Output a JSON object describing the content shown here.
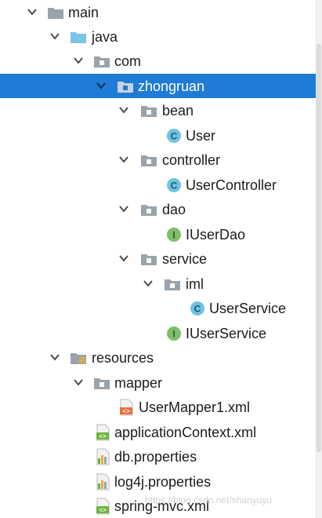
{
  "tree": {
    "main": "main",
    "java": "java",
    "com": "com",
    "zhongruan": "zhongruan",
    "bean": "bean",
    "user": "User",
    "controller": "controller",
    "user_controller": "UserController",
    "dao": "dao",
    "iuser_dao": "IUserDao",
    "service": "service",
    "iml": "iml",
    "user_service": "UserService",
    "iuser_service": "IUserService",
    "resources": "resources",
    "mapper": "mapper",
    "user_mapper": "UserMapper1.xml",
    "application_context": "applicationContext.xml",
    "db_properties": "db.properties",
    "log4j_properties": "log4j.properties",
    "spring_mvc": "spring-mvc.xml"
  },
  "icons": {
    "class_badge": "C",
    "interface_badge": "I"
  },
  "watermark": "https://blog.csdn.net/shanyuyu",
  "colors": {
    "selection": "#1e7bd6",
    "class_icon": "#6fc2e2",
    "interface_icon": "#7fbd6a",
    "folder_gray": "#9aa3ab",
    "source_folder": "#7cc4ea"
  }
}
